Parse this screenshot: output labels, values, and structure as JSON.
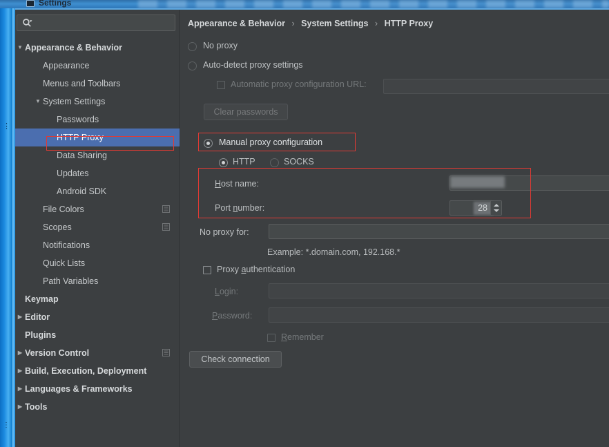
{
  "window": {
    "title": "Settings",
    "icon": "settings-window-icon"
  },
  "sidebar": {
    "search": {
      "value": "",
      "placeholder": "",
      "icon": "search-icon",
      "dropdown_icon": "chevron-down-icon"
    },
    "items": [
      {
        "label": "Appearance & Behavior",
        "indent": 14,
        "twisty": "▼",
        "bold": true,
        "selected": false,
        "cfg_icon": false
      },
      {
        "label": "Appearance",
        "indent": 40,
        "twisty": "",
        "bold": false,
        "selected": false,
        "cfg_icon": false
      },
      {
        "label": "Menus and Toolbars",
        "indent": 40,
        "twisty": "",
        "bold": false,
        "selected": false,
        "cfg_icon": false
      },
      {
        "label": "System Settings",
        "indent": 40,
        "twisty": "▼",
        "bold": false,
        "selected": false,
        "cfg_icon": false
      },
      {
        "label": "Passwords",
        "indent": 60,
        "twisty": "",
        "bold": false,
        "selected": false,
        "cfg_icon": false
      },
      {
        "label": "HTTP Proxy",
        "indent": 60,
        "twisty": "",
        "bold": false,
        "selected": true,
        "cfg_icon": false
      },
      {
        "label": "Data Sharing",
        "indent": 60,
        "twisty": "",
        "bold": false,
        "selected": false,
        "cfg_icon": false
      },
      {
        "label": "Updates",
        "indent": 60,
        "twisty": "",
        "bold": false,
        "selected": false,
        "cfg_icon": false
      },
      {
        "label": "Android SDK",
        "indent": 60,
        "twisty": "",
        "bold": false,
        "selected": false,
        "cfg_icon": false
      },
      {
        "label": "File Colors",
        "indent": 40,
        "twisty": "",
        "bold": false,
        "selected": false,
        "cfg_icon": true
      },
      {
        "label": "Scopes",
        "indent": 40,
        "twisty": "",
        "bold": false,
        "selected": false,
        "cfg_icon": true
      },
      {
        "label": "Notifications",
        "indent": 40,
        "twisty": "",
        "bold": false,
        "selected": false,
        "cfg_icon": false
      },
      {
        "label": "Quick Lists",
        "indent": 40,
        "twisty": "",
        "bold": false,
        "selected": false,
        "cfg_icon": false
      },
      {
        "label": "Path Variables",
        "indent": 40,
        "twisty": "",
        "bold": false,
        "selected": false,
        "cfg_icon": false
      },
      {
        "label": "Keymap",
        "indent": 14,
        "twisty": "",
        "bold": true,
        "selected": false,
        "cfg_icon": false
      },
      {
        "label": "Editor",
        "indent": 14,
        "twisty": "▶",
        "bold": true,
        "selected": false,
        "cfg_icon": false
      },
      {
        "label": "Plugins",
        "indent": 14,
        "twisty": "",
        "bold": true,
        "selected": false,
        "cfg_icon": false
      },
      {
        "label": "Version Control",
        "indent": 14,
        "twisty": "▶",
        "bold": true,
        "selected": false,
        "cfg_icon": true
      },
      {
        "label": "Build, Execution, Deployment",
        "indent": 14,
        "twisty": "▶",
        "bold": true,
        "selected": false,
        "cfg_icon": false
      },
      {
        "label": "Languages & Frameworks",
        "indent": 14,
        "twisty": "▶",
        "bold": true,
        "selected": false,
        "cfg_icon": false
      },
      {
        "label": "Tools",
        "indent": 14,
        "twisty": "▶",
        "bold": true,
        "selected": false,
        "cfg_icon": false
      }
    ]
  },
  "content": {
    "breadcrumb": {
      "part1": "Appearance & Behavior",
      "part2": "System Settings",
      "part3": "HTTP Proxy",
      "separator": "›"
    },
    "proxy_mode": {
      "no_proxy": "No proxy",
      "auto_detect": "Auto-detect proxy settings",
      "manual": "Manual proxy configuration",
      "selected": "manual"
    },
    "auto_pac": {
      "label": "Automatic proxy configuration URL:",
      "value": "",
      "checked": false,
      "enabled": false
    },
    "clear_passwords_button": "Clear passwords",
    "protocol": {
      "http": "HTTP",
      "socks": "SOCKS",
      "selected": "http"
    },
    "host_name": {
      "label": "Host name:",
      "mnemonic": "H",
      "value": ""
    },
    "port_number": {
      "label": "Port number:",
      "mnemonic": "n",
      "value": "28"
    },
    "no_proxy_for": {
      "label": "No proxy for:",
      "value": ""
    },
    "example_hint": "Example: *.domain.com, 192.168.*",
    "proxy_auth": {
      "label": "Proxy authentication",
      "checked": false
    },
    "login": {
      "label": "Login:",
      "value": ""
    },
    "password": {
      "label": "Password:",
      "value": ""
    },
    "remember": {
      "label": "Remember",
      "checked": false
    },
    "check_connection_button": "Check connection"
  },
  "annotations": {
    "color": "#e03a34",
    "boxes": [
      "http-proxy-sidebar-item",
      "manual-proxy-configuration",
      "host-and-port-fields"
    ]
  },
  "colors": {
    "panel_bg": "#3c3f41",
    "selection_blue": "#4b6eaf",
    "titlebar_blue": "#3f8fd0",
    "annotation_red": "#e03a34",
    "text": "#bdc0c2"
  }
}
